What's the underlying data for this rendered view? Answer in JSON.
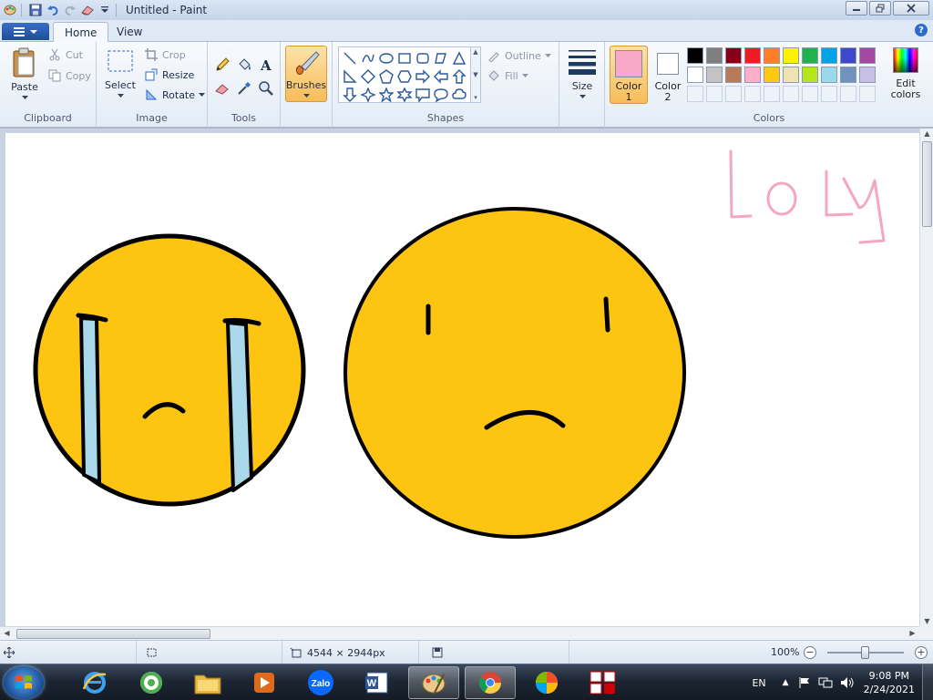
{
  "window": {
    "title": "Untitled - Paint"
  },
  "tabs": {
    "home": "Home",
    "view": "View",
    "help": "?"
  },
  "clipboard": {
    "label": "Clipboard",
    "paste": "Paste",
    "cut": "Cut",
    "copy": "Copy"
  },
  "image": {
    "label": "Image",
    "select": "Select",
    "crop": "Crop",
    "resize": "Resize",
    "rotate": "Rotate"
  },
  "tools": {
    "label": "Tools"
  },
  "brushes": {
    "label": "Brushes"
  },
  "shapes": {
    "label": "Shapes",
    "outline": "Outline",
    "fill": "Fill"
  },
  "size": {
    "label": "Size"
  },
  "colors": {
    "label": "Colors",
    "color1_label_line1": "Color",
    "color1_label_line2": "1",
    "color2_label_line1": "Color",
    "color2_label_line2": "2",
    "edit_line1": "Edit",
    "edit_line2": "colors",
    "color1_value": "#f9a8c8",
    "color2_value": "#ffffff",
    "palette_row1": [
      "#000000",
      "#7f7f7f",
      "#880015",
      "#ed1c24",
      "#ff7f27",
      "#fff200",
      "#22b14c",
      "#00a2e8",
      "#3f48cc",
      "#a349a4"
    ],
    "palette_row2": [
      "#ffffff",
      "#c3c3c3",
      "#b97a57",
      "#ffaec9",
      "#ffc90e",
      "#efe4b0",
      "#b5e61d",
      "#99d9ea",
      "#7092be",
      "#c8bfe7"
    ]
  },
  "canvas": {
    "handwriting": "Lo ly",
    "ink_color": "#f4a6c4",
    "face_color": "#fec412",
    "tear_color": "#a8d8ea"
  },
  "status": {
    "dimensions": "4544 × 2944px",
    "zoom": "100%"
  },
  "taskbar": {
    "language": "EN",
    "time": "9:08 PM",
    "date": "2/24/2021",
    "apps": [
      "internet-explorer",
      "coccoc-browser",
      "file-explorer",
      "media-player",
      "zalo",
      "word",
      "paint",
      "chrome",
      "picture-app",
      "unikey"
    ],
    "zalo_label": "Zalo",
    "word_label": "W"
  }
}
